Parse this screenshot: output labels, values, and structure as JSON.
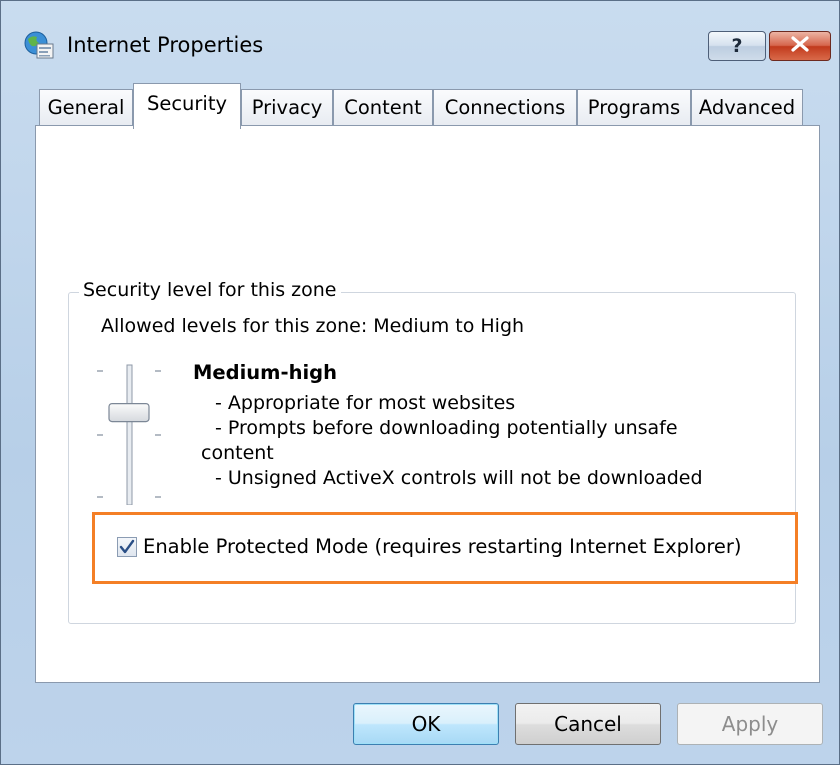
{
  "window": {
    "title": "Internet Properties",
    "help_label": "?"
  },
  "tabs": [
    {
      "label": "General",
      "active": false
    },
    {
      "label": "Security",
      "active": true
    },
    {
      "label": "Privacy",
      "active": false
    },
    {
      "label": "Content",
      "active": false
    },
    {
      "label": "Connections",
      "active": false
    },
    {
      "label": "Programs",
      "active": false
    },
    {
      "label": "Advanced",
      "active": false
    }
  ],
  "security": {
    "group_title": "Security level for this zone",
    "allowed_levels": "Allowed levels for this zone: Medium to High",
    "level_name": "Medium-high",
    "level_description": [
      "- Appropriate for most websites",
      "- Prompts before downloading potentially unsafe",
      "content",
      "- Unsigned ActiveX controls will not be downloaded"
    ],
    "slider_level_fraction": 0.33,
    "protected_mode": {
      "label": "Enable Protected Mode (requires restarting Internet Explorer)",
      "checked": true
    }
  },
  "footer": {
    "ok_label": "OK",
    "cancel_label": "Cancel",
    "apply_label": "Apply"
  },
  "colors": {
    "highlight": "#f47f26",
    "accent_blue": "#3c7fb1"
  }
}
